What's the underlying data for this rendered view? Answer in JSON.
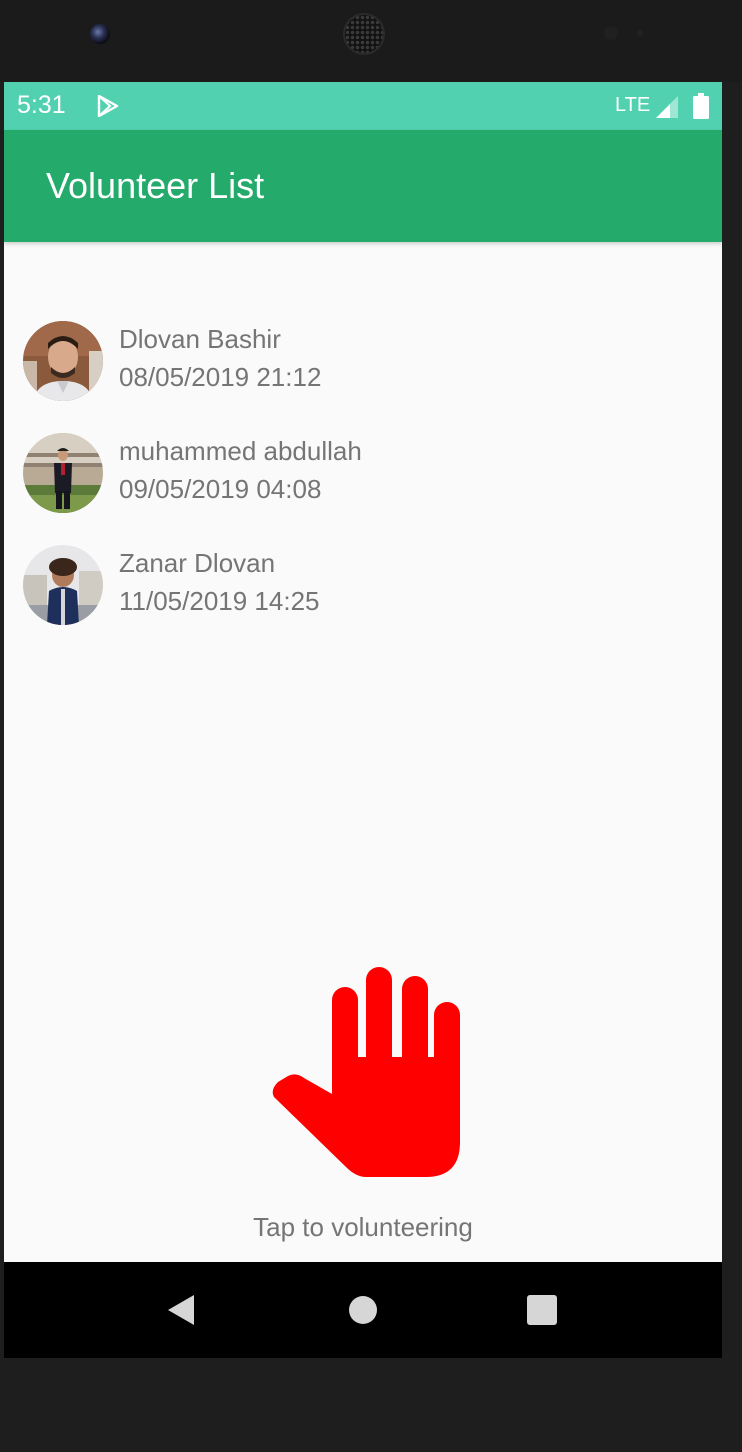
{
  "status_bar": {
    "time": "5:31",
    "network": "LTE",
    "icons": [
      "play-store-icon",
      "signal-icon",
      "battery-icon"
    ]
  },
  "app_bar": {
    "title": "Volunteer List"
  },
  "volunteers": [
    {
      "name": "Dlovan Bashir",
      "datetime": "08/05/2019 21:12",
      "avatar": "avatar-photo"
    },
    {
      "name": "muhammed abdullah",
      "datetime": "09/05/2019 04:08",
      "avatar": "avatar-photo"
    },
    {
      "name": "Zanar Dlovan",
      "datetime": "11/05/2019 14:25",
      "avatar": "avatar-photo"
    }
  ],
  "volunteer_action": {
    "icon": "hand-icon",
    "label": "Tap to volunteering",
    "icon_color": "#ff0000"
  },
  "nav_bar": {
    "icons": [
      "back-icon",
      "home-icon",
      "recent-apps-icon"
    ]
  },
  "colors": {
    "status_bar": "#52d1b1",
    "app_bar": "#24aa6a",
    "background": "#fafafa",
    "text_secondary": "#757575"
  }
}
